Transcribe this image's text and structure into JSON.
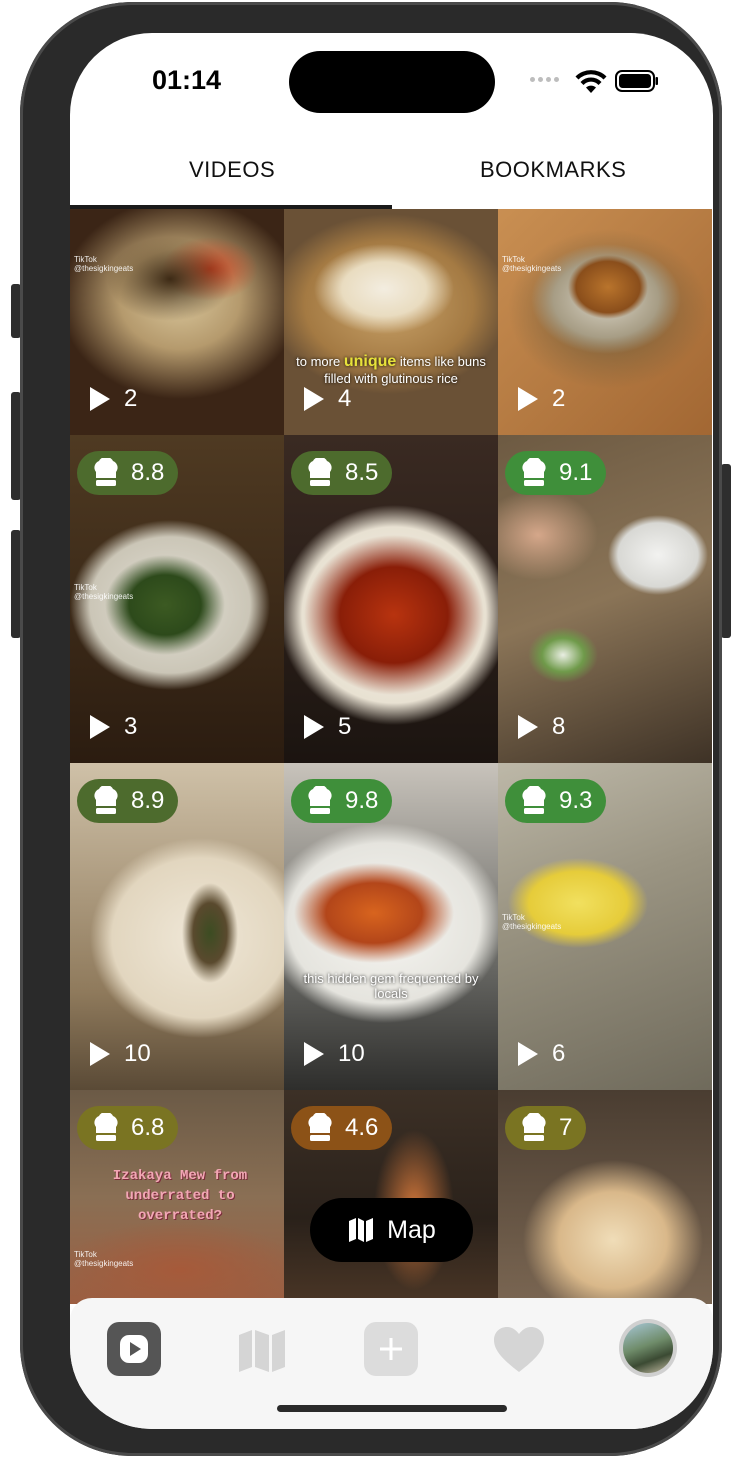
{
  "status": {
    "time": "01:14"
  },
  "tabs": [
    {
      "label": "VIDEOS",
      "active": true
    },
    {
      "label": "BOOKMARKS",
      "active": false
    }
  ],
  "tiles": [
    {
      "plays": "2",
      "score": null
    },
    {
      "plays": "4",
      "score": null,
      "caption_a": "to more",
      "caption_highlight": "unique",
      "caption_b": "items like buns filled with glutinous rice"
    },
    {
      "plays": "2",
      "score": null
    },
    {
      "plays": "3",
      "score": "8.8",
      "badge_color": "#4d6b2d"
    },
    {
      "plays": "5",
      "score": "8.5",
      "badge_color": "#4d6b2d"
    },
    {
      "plays": "8",
      "score": "9.1",
      "badge_color": "#3f8f3a"
    },
    {
      "plays": "10",
      "score": "8.9",
      "badge_color": "#4d6b2d"
    },
    {
      "plays": "10",
      "score": "9.8",
      "badge_color": "#3f8f3a",
      "caption": "this hidden gem frequented by locals"
    },
    {
      "plays": "6",
      "score": "9.3",
      "badge_color": "#3f8f3a"
    },
    {
      "plays": null,
      "score": "6.8",
      "badge_color": "#7a7422",
      "overlay_text": "Izakaya Mew from underrated to overrated?"
    },
    {
      "plays": null,
      "score": "4.6",
      "badge_color": "#8c5217"
    },
    {
      "plays": null,
      "score": "7",
      "badge_color": "#7a7422"
    }
  ],
  "watermark": {
    "brand": "TikTok",
    "handle": "@thesigkingeats"
  },
  "map_button": {
    "label": "Map",
    "icon": "map-icon"
  },
  "tabbar": [
    {
      "icon": "play-icon",
      "active": true
    },
    {
      "icon": "map-icon",
      "active": false
    },
    {
      "icon": "plus-icon",
      "active": false
    },
    {
      "icon": "heart-icon",
      "active": false
    },
    {
      "icon": "avatar",
      "active": false
    }
  ],
  "colors": {
    "badge_dark_green": "#4d6b2d",
    "badge_green": "#3f8f3a",
    "badge_olive": "#7a7422",
    "badge_brown": "#8c5217"
  }
}
